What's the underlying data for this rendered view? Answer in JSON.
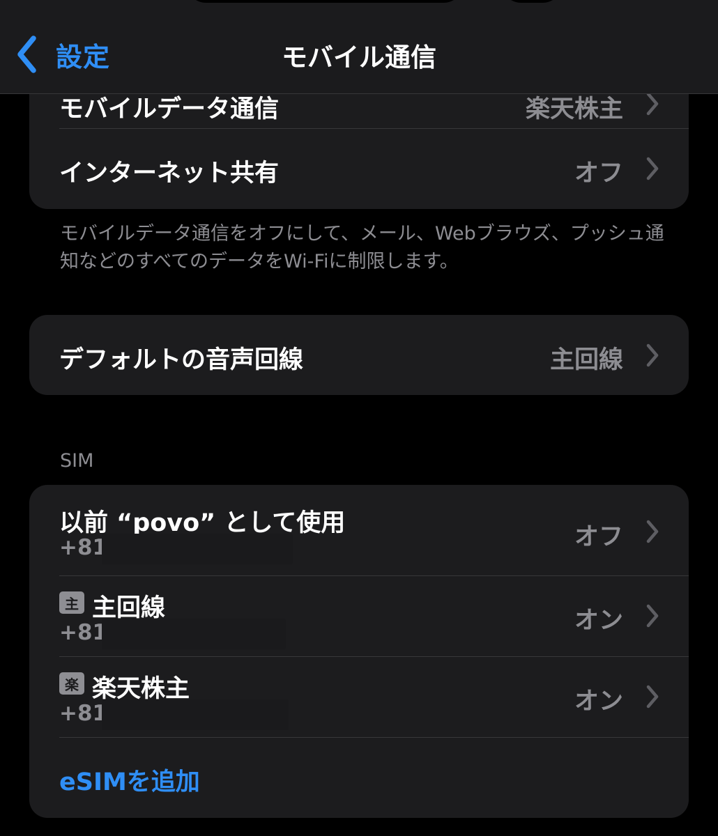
{
  "nav": {
    "back_label": "設定",
    "title": "モバイル通信"
  },
  "group1": {
    "partial_row": {
      "label": "モバイルデータ通信",
      "value": "楽天株主"
    },
    "hotspot": {
      "label": "インターネット共有",
      "value": "オフ"
    }
  },
  "footer_note": "モバイルデータ通信をオフにして、メール、Webブラウズ、プッシュ通知などのすべてのデータをWi-Fiに制限します。",
  "group2": {
    "default_voice": {
      "label": "デフォルトの音声回線",
      "value": "主回線"
    }
  },
  "sim_section": {
    "header": "SIM",
    "items": [
      {
        "label": "以前 “povo” として使用",
        "number": "+81",
        "status": "オフ",
        "badge": ""
      },
      {
        "label": "主回線",
        "number": "+81",
        "status": "オン",
        "badge": "主"
      },
      {
        "label": "楽天株主",
        "number": "+81",
        "status": "オン",
        "badge": "楽"
      }
    ],
    "add_esim": "eSIMを追加"
  },
  "colors": {
    "accent": "#2f8ef5",
    "background": "#000000",
    "card": "#1c1c1e",
    "secondary_text": "#8d8d92",
    "separator": "#38383a"
  }
}
